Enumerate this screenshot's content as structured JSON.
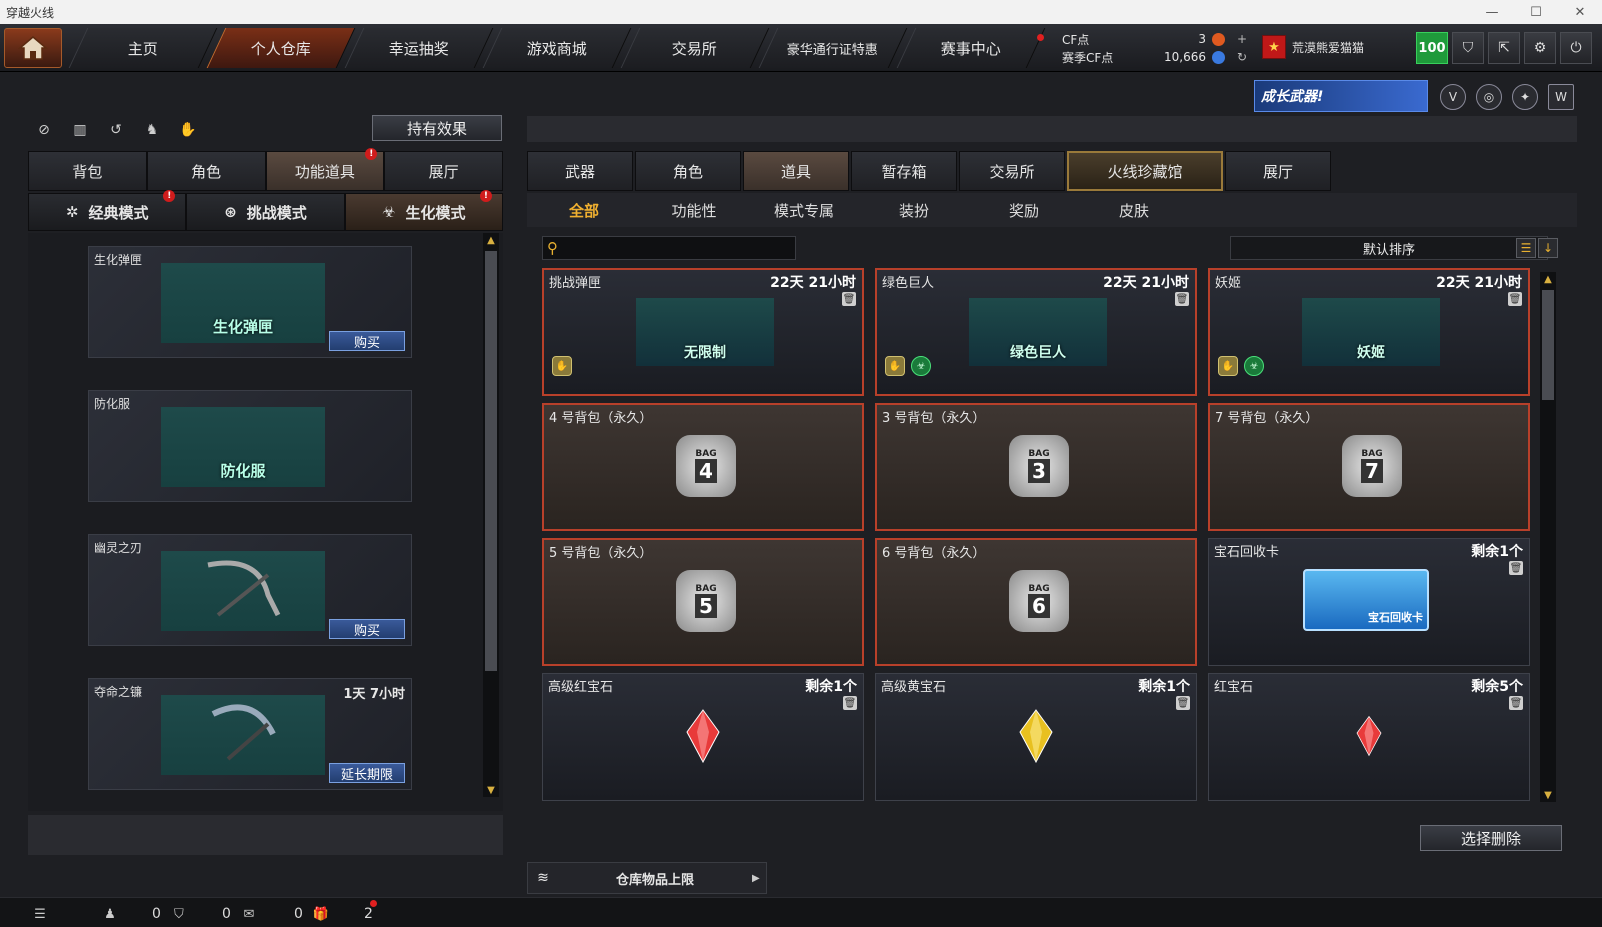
{
  "window": {
    "title": "穿越火线",
    "minimize": "—",
    "maximize": "☐",
    "close": "✕"
  },
  "nav": {
    "tabs": [
      "主页",
      "个人仓库",
      "幸运抽奖",
      "游戏商城",
      "交易所",
      "豪华通行证特惠",
      "赛事中心"
    ],
    "active_index": 1
  },
  "currency": {
    "cf_label": "CF点",
    "cf_value": "3",
    "season_label": "赛季CF点",
    "season_value": "10,666",
    "plus": "+",
    "refresh": "↻"
  },
  "player": {
    "name": "荒漠熊爱猫猫",
    "flag_icon": "★",
    "level": "100"
  },
  "top_icons": [
    "shield-icon",
    "export-icon",
    "gear-icon",
    "power-icon"
  ],
  "promo": {
    "text": "成长武器!"
  },
  "left": {
    "effect_button": "持有效果",
    "tabs": [
      "背包",
      "角色",
      "功能道具",
      "展厅"
    ],
    "active_tab": 2,
    "modes": [
      "经典模式",
      "挑战模式",
      "生化模式"
    ],
    "active_mode": 2,
    "cards": [
      {
        "title": "生化弹匣",
        "img_label": "生化弹匣",
        "timer": "",
        "action": "购买"
      },
      {
        "title": "防化服",
        "img_label": "防化服",
        "timer": "",
        "action": ""
      },
      {
        "title": "幽灵之刃",
        "img_label": "",
        "timer": "",
        "action": "购买"
      },
      {
        "title": "夺命之镰",
        "img_label": "",
        "timer": "1天 7小时",
        "action": "延长期限"
      }
    ]
  },
  "right": {
    "tabs": [
      "武器",
      "角色",
      "道具",
      "暂存箱",
      "交易所",
      "火线珍藏馆",
      "展厅"
    ],
    "active_tab": 2,
    "subtabs": [
      "全部",
      "功能性",
      "模式专属",
      "装扮",
      "奖励",
      "皮肤"
    ],
    "active_subtab": 0,
    "search": {
      "placeholder": ""
    },
    "sort_label": "默认排序",
    "items": [
      {
        "name": "挑战弹匣",
        "time": "22天 21小时",
        "kind": "ammo",
        "label": "无限制",
        "style": "red"
      },
      {
        "name": "绿色巨人",
        "time": "22天 21小时",
        "kind": "char",
        "label": "绿色巨人",
        "style": "red"
      },
      {
        "name": "妖姬",
        "time": "22天 21小时",
        "kind": "char",
        "label": "妖姬",
        "style": "red"
      },
      {
        "name": "4 号背包（永久）",
        "time": "",
        "kind": "bag",
        "label": "4",
        "style": "brown"
      },
      {
        "name": "3 号背包（永久）",
        "time": "",
        "kind": "bag",
        "label": "3",
        "style": "brown"
      },
      {
        "name": "7 号背包（永久）",
        "time": "",
        "kind": "bag",
        "label": "7",
        "style": "brown"
      },
      {
        "name": "5 号背包（永久）",
        "time": "",
        "kind": "bag",
        "label": "5",
        "style": "brown"
      },
      {
        "name": "6 号背包（永久）",
        "time": "",
        "kind": "bag",
        "label": "6",
        "style": "brown"
      },
      {
        "name": "宝石回收卡",
        "time": "剩余1个",
        "kind": "card",
        "label": "宝石回收卡",
        "style": "plain"
      },
      {
        "name": "高级红宝石",
        "time": "剩余1个",
        "kind": "gem-red",
        "label": "",
        "style": "plain"
      },
      {
        "name": "高级黄宝石",
        "time": "剩余1个",
        "kind": "gem-yellow",
        "label": "",
        "style": "plain"
      },
      {
        "name": "红宝石",
        "time": "剩余5个",
        "kind": "gem-red-small",
        "label": "",
        "style": "plain"
      }
    ],
    "bag_text": "BAG",
    "delete_button": "选择删除",
    "capacity_label": "仓库物品上限"
  },
  "statusbar": {
    "count_a": "0",
    "count_b": "0",
    "count_c": "0",
    "count_d": "2"
  },
  "colors": {
    "accent": "#f0b030",
    "active_nav": "#7a2f16",
    "item_border_red": "#b8402a"
  }
}
